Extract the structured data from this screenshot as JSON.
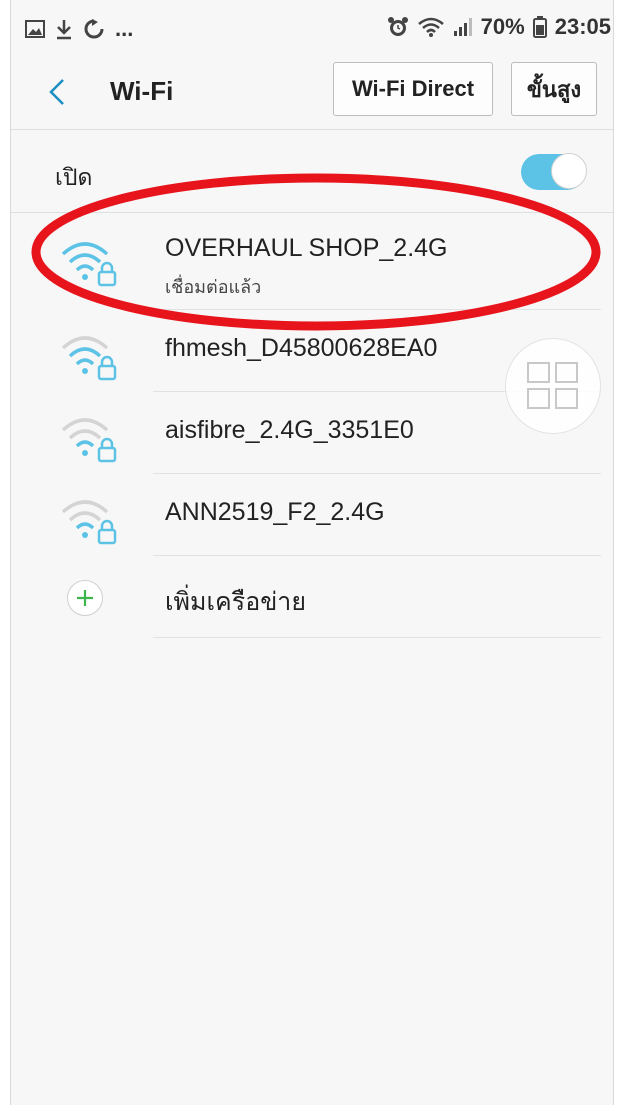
{
  "status_bar": {
    "left_icons": [
      "gallery-icon",
      "download-icon",
      "sync-icon"
    ],
    "overflow": "...",
    "right_icons": [
      "alarm-icon",
      "wifi-signal-icon",
      "cell-signal-icon"
    ],
    "battery_percent": "70%",
    "battery_icon": "battery-icon",
    "time": "23:05"
  },
  "header": {
    "title": "Wi-Fi",
    "wifi_direct_label": "Wi-Fi Direct",
    "advanced_label": "ขั้นสูง"
  },
  "toggle": {
    "label": "เปิด",
    "state": "on",
    "accent_color": "#5cc3e6"
  },
  "networks": [
    {
      "name": "OVERHAUL SHOP_2.4G",
      "status": "เชื่อมต่อแล้ว",
      "connected": true,
      "icon": "wifi-lock-icon"
    },
    {
      "name": "fhmesh_D45800628EA0",
      "status": "",
      "connected": false,
      "icon": "wifi-lock-icon"
    },
    {
      "name": "aisfibre_2.4G_3351E0",
      "status": "",
      "connected": false,
      "icon": "wifi-lock-icon"
    },
    {
      "name": "ANN2519_F2_2.4G",
      "status": "",
      "connected": false,
      "icon": "wifi-lock-icon"
    }
  ],
  "add_network": {
    "label": "เพิ่มเครือข่าย",
    "icon": "plus-icon"
  },
  "annotation": {
    "shape": "ellipse",
    "color": "#e8141c"
  }
}
